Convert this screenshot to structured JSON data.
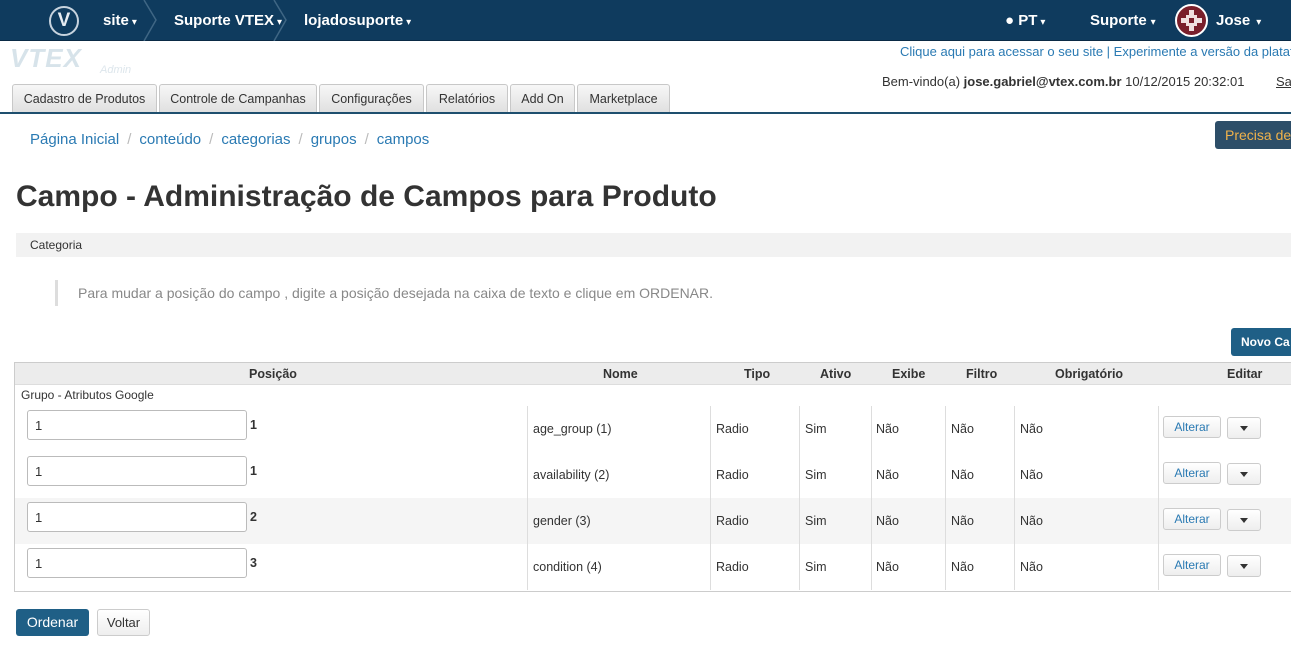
{
  "topbar": {
    "logo_icon": "vtex-v-icon",
    "crumbs": [
      {
        "label": "site"
      },
      {
        "label": "Suporte VTEX"
      },
      {
        "label": "lojadosuporte"
      }
    ],
    "language": "PT",
    "support": "Suporte",
    "user": "Jose",
    "bg_color": "#0f3b5e"
  },
  "header": {
    "logo_text": "VTEX",
    "logo_sub": "Admin",
    "link_site": "Clique aqui para acessar o seu site",
    "link_sep": " | ",
    "link_new": "Experimente a versão da platafo",
    "welcome_prefix": "Bem-vindo(a) ",
    "welcome_email": "jose.gabriel@vtex.com.br",
    "welcome_datetime": " 10/12/2015 20:32:01",
    "logout": "Sa"
  },
  "tabs": [
    {
      "label": "Cadastro de Produtos"
    },
    {
      "label": "Controle de Campanhas"
    },
    {
      "label": "Configurações"
    },
    {
      "label": "Relatórios"
    },
    {
      "label": "Add On"
    },
    {
      "label": "Marketplace"
    }
  ],
  "breadcrumb": [
    "Página Inicial",
    "conteúdo",
    "categorias",
    "grupos",
    "campos"
  ],
  "help_button": "Precisa de a",
  "page_title": "Campo - Administração de Campos para Produto",
  "category_label": "Categoria",
  "hint": "Para mudar a posição do campo , digite a posição desejada na caixa de texto e clique em ORDENAR.",
  "new_button": "Novo Ca",
  "table": {
    "headers": {
      "posicao": "Posição",
      "nome": "Nome",
      "tipo": "Tipo",
      "ativo": "Ativo",
      "exibe": "Exibe",
      "filtro": "Filtro",
      "obrigatorio": "Obrigatório",
      "editar": "Editar"
    },
    "group": "Grupo - Atributos Google",
    "rows": [
      {
        "input": "1",
        "pos": "1",
        "nome": "age_group (1)",
        "tipo": "Radio",
        "ativo": "Sim",
        "exibe": "Não",
        "filtro": "Não",
        "obrigatorio": "Não",
        "action": "Alterar"
      },
      {
        "input": "1",
        "pos": "1",
        "nome": "availability (2)",
        "tipo": "Radio",
        "ativo": "Sim",
        "exibe": "Não",
        "filtro": "Não",
        "obrigatorio": "Não",
        "action": "Alterar"
      },
      {
        "input": "1",
        "pos": "2",
        "nome": "gender (3)",
        "tipo": "Radio",
        "ativo": "Sim",
        "exibe": "Não",
        "filtro": "Não",
        "obrigatorio": "Não",
        "action": "Alterar"
      },
      {
        "input": "1",
        "pos": "3",
        "nome": "condition (4)",
        "tipo": "Radio",
        "ativo": "Sim",
        "exibe": "Não",
        "filtro": "Não",
        "obrigatorio": "Não",
        "action": "Alterar"
      }
    ]
  },
  "footer": {
    "order_button": "Ordenar",
    "back_button": "Voltar"
  }
}
